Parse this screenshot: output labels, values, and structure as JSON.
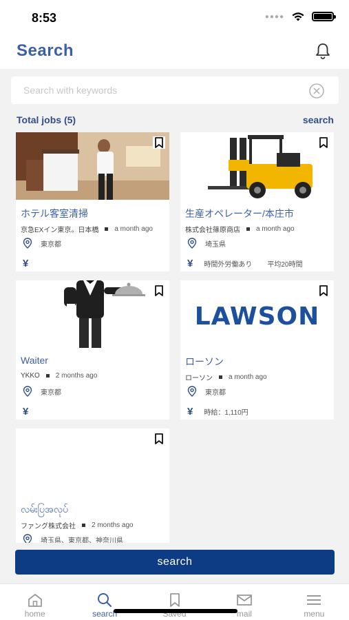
{
  "status": {
    "time": "8:53"
  },
  "header": {
    "title": "Search"
  },
  "search": {
    "placeholder": "Search with keywords",
    "value": ""
  },
  "results": {
    "total_label": "Total jobs (5)",
    "search_link": "search"
  },
  "jobs": [
    {
      "title": "ホテル客室清掃",
      "company": "京急EXイン東京。日本橋",
      "time": "a month ago",
      "location": "東京都",
      "wage": "",
      "wage_extra": "",
      "image": "hotel-housekeeping-photo"
    },
    {
      "title": "生産オペレーター/本庄市",
      "company": "株式会社篠原商店",
      "time": "a month ago",
      "location": "埼玉県",
      "wage": "時間外労働あり",
      "wage_extra": "平均20時間",
      "image": "forklift-photo"
    },
    {
      "title": "Waiter",
      "company": "YKKO",
      "time": "2 months ago",
      "location": "東京都",
      "wage": "",
      "wage_extra": "",
      "image": "waiter-illustration"
    },
    {
      "title": "ローソン",
      "company": "ローソン",
      "time": "a month ago",
      "location": "東京都",
      "wage": "時給：1,110円",
      "wage_extra": "",
      "image": "lawson-logo",
      "logo_text": "LAWSON"
    },
    {
      "title": "လမ်းပြအလုပ်",
      "company": "ファング株式会社",
      "time": "2 months ago",
      "location": "埼玉県、東京都、神奈川県",
      "wage": "",
      "wage_extra": "",
      "image": ""
    }
  ],
  "cta": {
    "label": "search"
  },
  "tabs": [
    {
      "label": "home",
      "icon": "home-icon"
    },
    {
      "label": "search",
      "icon": "search-icon",
      "active": true
    },
    {
      "label": "Saved",
      "icon": "bookmark-icon"
    },
    {
      "label": "mail",
      "icon": "mail-icon"
    },
    {
      "label": "menu",
      "icon": "menu-icon"
    }
  ],
  "colors": {
    "brand": "#3d5fa8",
    "cta": "#0d3c84",
    "background": "#f2f2f2",
    "lawson": "#1d4f9f"
  }
}
